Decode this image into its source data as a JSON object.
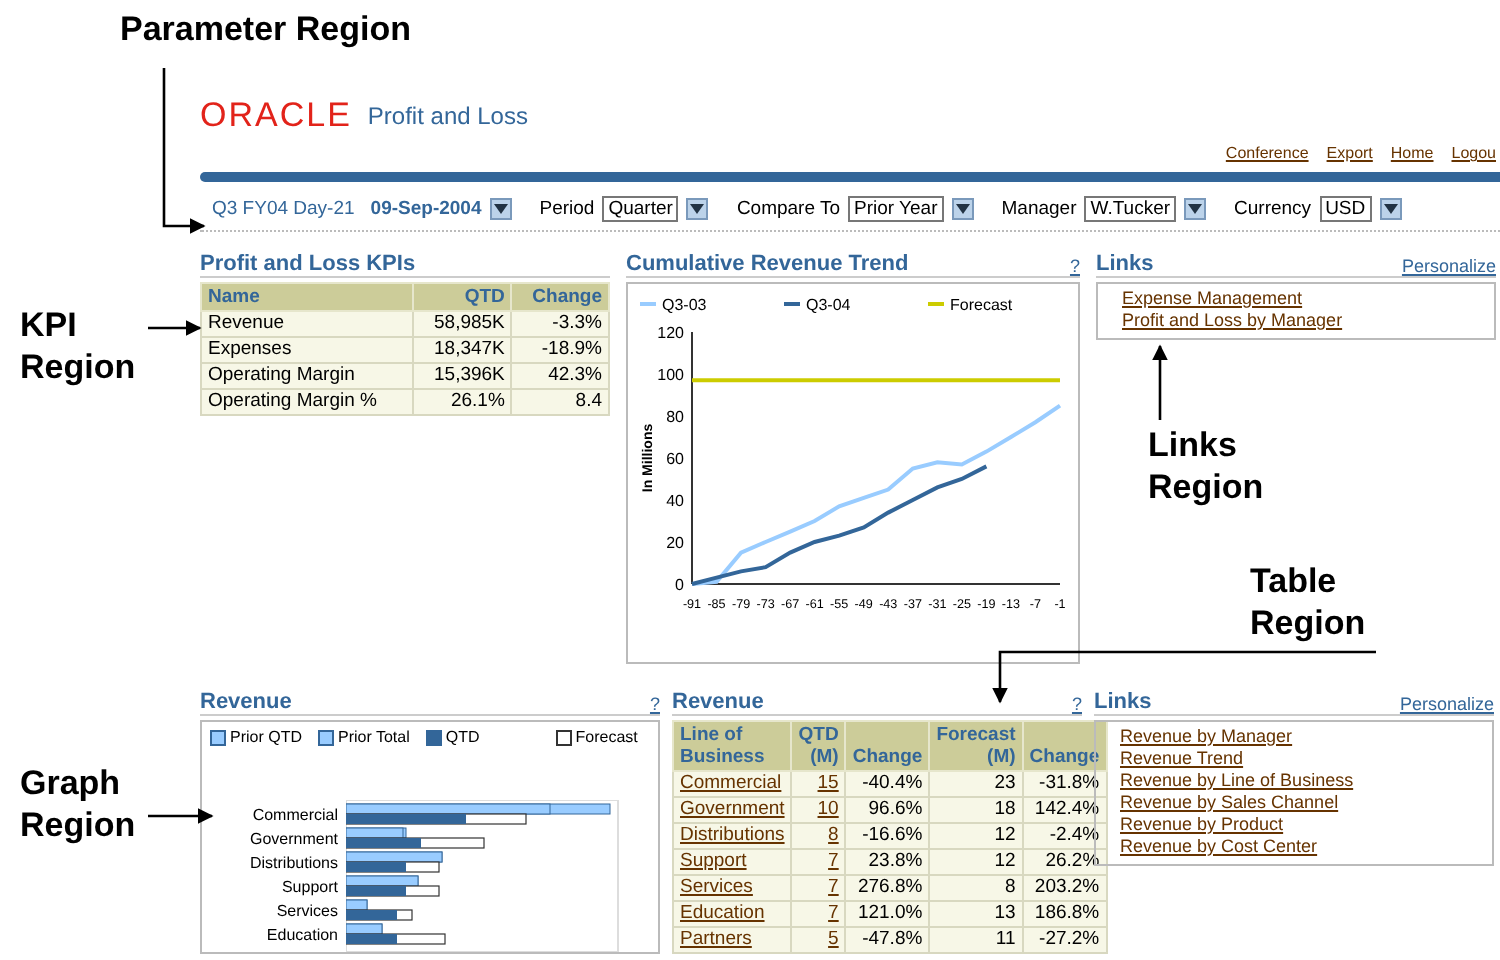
{
  "annotations": [
    {
      "kind": "parameter",
      "label": "Parameter Region"
    },
    {
      "kind": "kpi",
      "label": "KPI Region"
    },
    {
      "kind": "links",
      "label": "Links Region"
    },
    {
      "kind": "table",
      "label": "Table Region"
    },
    {
      "kind": "graph",
      "label": "Graph Region"
    }
  ],
  "header": {
    "logo": "ORACLE",
    "title": "Profit and Loss",
    "global_links": [
      "Conference",
      "Export",
      "Home",
      "Logou"
    ]
  },
  "parameters": {
    "period_label": "Q3 FY04 Day-21",
    "date": "09-Sep-2004",
    "fields": [
      {
        "label": "Period",
        "value": "Quarter"
      },
      {
        "label": "Compare To",
        "value": "Prior Year"
      },
      {
        "label": "Manager",
        "value": "W.Tucker"
      },
      {
        "label": "Currency",
        "value": "USD"
      }
    ]
  },
  "kpi": {
    "title": "Profit and Loss KPIs",
    "columns": [
      "Name",
      "QTD",
      "Change"
    ],
    "rows": [
      [
        "Revenue",
        "58,985K",
        "-3.3%"
      ],
      [
        "Expenses",
        "18,347K",
        "-18.9%"
      ],
      [
        "Operating Margin",
        "15,396K",
        "42.3%"
      ],
      [
        "Operating Margin %",
        "26.1%",
        "8.4"
      ]
    ]
  },
  "trend": {
    "title": "Cumulative Revenue Trend",
    "help": "?",
    "chart_data": {
      "type": "line",
      "ylabel": "In Millions",
      "x": [
        -91,
        -85,
        -79,
        -73,
        -67,
        -61,
        -55,
        -49,
        -43,
        -37,
        -31,
        -25,
        -19,
        -13,
        -7,
        -1
      ],
      "series": [
        {
          "name": "Q3-03",
          "color": "#99ccff",
          "values": [
            0,
            1,
            15,
            20,
            25,
            30,
            37,
            41,
            45,
            55,
            58,
            57,
            63,
            70,
            77,
            85
          ]
        },
        {
          "name": "Q3-04",
          "color": "#336699",
          "values": [
            0,
            3,
            6,
            8,
            15,
            20,
            23,
            27,
            34,
            40,
            46,
            50,
            56,
            null,
            null,
            null
          ]
        },
        {
          "name": "Forecast",
          "color": "#cccc00",
          "values": [
            97,
            97,
            97,
            97,
            97,
            97,
            97,
            97,
            97,
            97,
            97,
            97,
            97,
            97,
            97,
            97
          ]
        }
      ],
      "legend": "top",
      "xlim": [
        -91,
        -1
      ],
      "ylim": [
        0,
        120
      ],
      "yticks": [
        0,
        20,
        40,
        60,
        80,
        100,
        120
      ],
      "xticks": [
        -91,
        -85,
        -79,
        -73,
        -67,
        -61,
        -55,
        -49,
        -43,
        -37,
        -31,
        -25,
        -19,
        -13,
        -7,
        -1
      ]
    }
  },
  "links_top": {
    "title": "Links",
    "personalize": "Personalize",
    "items": [
      "Expense Management",
      "Profit and Loss by Manager"
    ]
  },
  "revenue_graph": {
    "title": "Revenue",
    "help": "?",
    "legend": [
      {
        "label": "Prior QTD",
        "color": "#99ccff"
      },
      {
        "label": "Prior Total",
        "color": "#99ccff"
      },
      {
        "label": "QTD",
        "color": "#336699"
      },
      {
        "label": "Forecast",
        "color": "#ffffff"
      }
    ],
    "categories": [
      "Commercial",
      "Government",
      "Distributions",
      "Support",
      "Services",
      "Education"
    ]
  },
  "revenue_table": {
    "title": "Revenue",
    "help": "?",
    "columns": [
      "Line of Business",
      "QTD (M)",
      "Change",
      "Forecast (M)",
      "Change"
    ],
    "rows": [
      [
        "Commercial",
        "15",
        "-40.4%",
        "23",
        "-31.8%"
      ],
      [
        "Government",
        "10",
        "96.6%",
        "18",
        "142.4%"
      ],
      [
        "Distributions",
        "8",
        "-16.6%",
        "12",
        "-2.4%"
      ],
      [
        "Support",
        "7",
        "23.8%",
        "12",
        "26.2%"
      ],
      [
        "Services",
        "7",
        "276.8%",
        "8",
        "203.2%"
      ],
      [
        "Education",
        "7",
        "121.0%",
        "13",
        "186.8%"
      ],
      [
        "Partners",
        "5",
        "-47.8%",
        "11",
        "-27.2%"
      ]
    ]
  },
  "links_bottom": {
    "title": "Links",
    "personalize": "Personalize",
    "items": [
      "Revenue by Manager",
      "Revenue Trend",
      "Revenue by Line of Business",
      "Revenue by Sales Channel",
      "Revenue by Product",
      "Revenue by Cost Center"
    ]
  }
}
